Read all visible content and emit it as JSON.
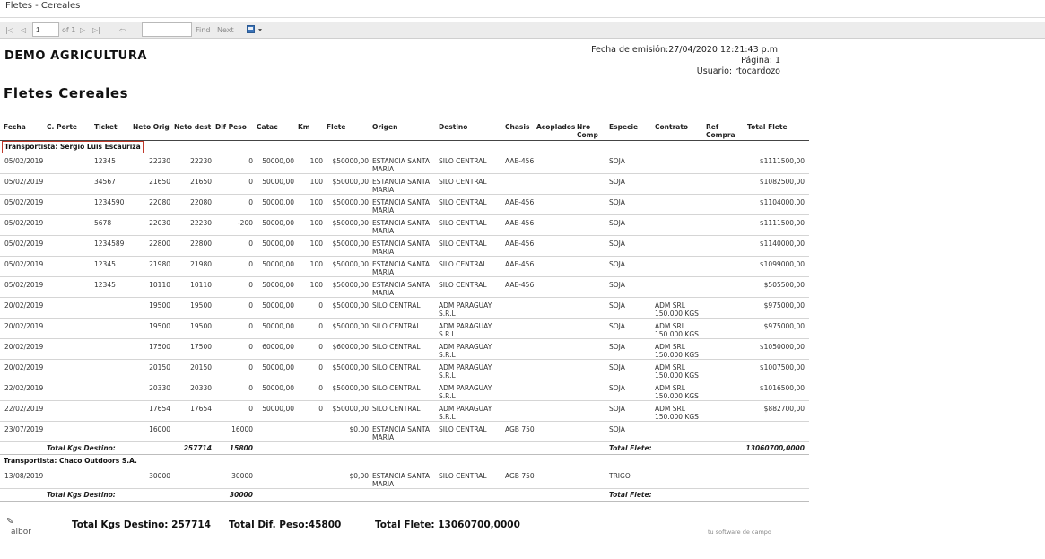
{
  "window": {
    "title": "Fletes - Cereales"
  },
  "toolbar": {
    "first_icon": "|◁",
    "prev_icon": "◁",
    "page_value": "1",
    "of_pages": "of 1",
    "next_icon": "▷",
    "last_icon": "▷|",
    "back_icon": "⇦",
    "search_value": "",
    "find_label": "Find",
    "separator": "|",
    "next_label": "Next",
    "export_icon": "save-icon"
  },
  "report": {
    "company": "DEMO AGRICULTURA",
    "title": "Fletes Cereales",
    "issue_line": "Fecha de emisión:27/04/2020 12:21:43 p.m.",
    "page_line": "Página: 1",
    "user_line": "Usuario: rtocardozo"
  },
  "columns": {
    "fecha": "Fecha",
    "cporte": "C. Porte",
    "ticket": "Ticket",
    "neto_orig": "Neto Orig",
    "neto_dest": "Neto dest",
    "dif_peso": "Dif Peso",
    "catac": "Catac",
    "km": "Km",
    "flete": "Flete",
    "origen": "Origen",
    "destino": "Destino",
    "chasis": "Chasis",
    "acoplados": "Acoplados",
    "nro_comp": "Nro Comp",
    "especie": "Especie",
    "contrato": "Contrato",
    "ref_compra": "Ref Compra",
    "total_flete": "Total Flete"
  },
  "groups": [
    {
      "title": "Transportista: Sergio Luis Escauriza",
      "rows": [
        {
          "fecha": "05/02/2019",
          "cporte": "",
          "ticket": "12345",
          "neto_orig": "22230",
          "neto_dest": "22230",
          "dif": "0",
          "catac": "50000,00",
          "km": "100",
          "flete": "$50000,00",
          "origen": "ESTANCIA SANTA MARIA",
          "destino": "SILO CENTRAL",
          "chasis": "AAE-456",
          "acoplados": "",
          "nro_comp": "",
          "especie": "SOJA",
          "contrato": "",
          "ref": "",
          "total": "$1111500,00"
        },
        {
          "fecha": "05/02/2019",
          "cporte": "",
          "ticket": "34567",
          "neto_orig": "21650",
          "neto_dest": "21650",
          "dif": "0",
          "catac": "50000,00",
          "km": "100",
          "flete": "$50000,00",
          "origen": "ESTANCIA SANTA MARIA",
          "destino": "SILO CENTRAL",
          "chasis": "",
          "acoplados": "",
          "nro_comp": "",
          "especie": "SOJA",
          "contrato": "",
          "ref": "",
          "total": "$1082500,00"
        },
        {
          "fecha": "05/02/2019",
          "cporte": "",
          "ticket": "1234590",
          "neto_orig": "22080",
          "neto_dest": "22080",
          "dif": "0",
          "catac": "50000,00",
          "km": "100",
          "flete": "$50000,00",
          "origen": "ESTANCIA SANTA MARIA",
          "destino": "SILO CENTRAL",
          "chasis": "AAE-456",
          "acoplados": "",
          "nro_comp": "",
          "especie": "SOJA",
          "contrato": "",
          "ref": "",
          "total": "$1104000,00"
        },
        {
          "fecha": "05/02/2019",
          "cporte": "",
          "ticket": "5678",
          "neto_orig": "22030",
          "neto_dest": "22230",
          "dif": "-200",
          "catac": "50000,00",
          "km": "100",
          "flete": "$50000,00",
          "origen": "ESTANCIA SANTA MARIA",
          "destino": "SILO CENTRAL",
          "chasis": "AAE-456",
          "acoplados": "",
          "nro_comp": "",
          "especie": "SOJA",
          "contrato": "",
          "ref": "",
          "total": "$1111500,00"
        },
        {
          "fecha": "05/02/2019",
          "cporte": "",
          "ticket": "1234589",
          "neto_orig": "22800",
          "neto_dest": "22800",
          "dif": "0",
          "catac": "50000,00",
          "km": "100",
          "flete": "$50000,00",
          "origen": "ESTANCIA SANTA MARIA",
          "destino": "SILO CENTRAL",
          "chasis": "AAE-456",
          "acoplados": "",
          "nro_comp": "",
          "especie": "SOJA",
          "contrato": "",
          "ref": "",
          "total": "$1140000,00"
        },
        {
          "fecha": "05/02/2019",
          "cporte": "",
          "ticket": "12345",
          "neto_orig": "21980",
          "neto_dest": "21980",
          "dif": "0",
          "catac": "50000,00",
          "km": "100",
          "flete": "$50000,00",
          "origen": "ESTANCIA SANTA MARIA",
          "destino": "SILO CENTRAL",
          "chasis": "AAE-456",
          "acoplados": "",
          "nro_comp": "",
          "especie": "SOJA",
          "contrato": "",
          "ref": "",
          "total": "$1099000,00"
        },
        {
          "fecha": "05/02/2019",
          "cporte": "",
          "ticket": "12345",
          "neto_orig": "10110",
          "neto_dest": "10110",
          "dif": "0",
          "catac": "50000,00",
          "km": "100",
          "flete": "$50000,00",
          "origen": "ESTANCIA SANTA MARIA",
          "destino": "SILO CENTRAL",
          "chasis": "AAE-456",
          "acoplados": "",
          "nro_comp": "",
          "especie": "SOJA",
          "contrato": "",
          "ref": "",
          "total": "$505500,00"
        },
        {
          "fecha": "20/02/2019",
          "cporte": "",
          "ticket": "",
          "neto_orig": "19500",
          "neto_dest": "19500",
          "dif": "0",
          "catac": "50000,00",
          "km": "0",
          "flete": "$50000,00",
          "origen": "SILO CENTRAL",
          "destino": "ADM PARAGUAY S.R.L",
          "chasis": "",
          "acoplados": "",
          "nro_comp": "",
          "especie": "SOJA",
          "contrato": "ADM SRL 150.000 KGS",
          "ref": "",
          "total": "$975000,00"
        },
        {
          "fecha": "20/02/2019",
          "cporte": "",
          "ticket": "",
          "neto_orig": "19500",
          "neto_dest": "19500",
          "dif": "0",
          "catac": "50000,00",
          "km": "0",
          "flete": "$50000,00",
          "origen": "SILO CENTRAL",
          "destino": "ADM PARAGUAY S.R.L",
          "chasis": "",
          "acoplados": "",
          "nro_comp": "",
          "especie": "SOJA",
          "contrato": "ADM SRL 150.000 KGS",
          "ref": "",
          "total": "$975000,00"
        },
        {
          "fecha": "20/02/2019",
          "cporte": "",
          "ticket": "",
          "neto_orig": "17500",
          "neto_dest": "17500",
          "dif": "0",
          "catac": "60000,00",
          "km": "0",
          "flete": "$60000,00",
          "origen": "SILO CENTRAL",
          "destino": "ADM PARAGUAY S.R.L",
          "chasis": "",
          "acoplados": "",
          "nro_comp": "",
          "especie": "SOJA",
          "contrato": "ADM SRL 150.000 KGS",
          "ref": "",
          "total": "$1050000,00"
        },
        {
          "fecha": "20/02/2019",
          "cporte": "",
          "ticket": "",
          "neto_orig": "20150",
          "neto_dest": "20150",
          "dif": "0",
          "catac": "50000,00",
          "km": "0",
          "flete": "$50000,00",
          "origen": "SILO CENTRAL",
          "destino": "ADM PARAGUAY S.R.L",
          "chasis": "",
          "acoplados": "",
          "nro_comp": "",
          "especie": "SOJA",
          "contrato": "ADM SRL 150.000 KGS",
          "ref": "",
          "total": "$1007500,00"
        },
        {
          "fecha": "22/02/2019",
          "cporte": "",
          "ticket": "",
          "neto_orig": "20330",
          "neto_dest": "20330",
          "dif": "0",
          "catac": "50000,00",
          "km": "0",
          "flete": "$50000,00",
          "origen": "SILO CENTRAL",
          "destino": "ADM PARAGUAY S.R.L",
          "chasis": "",
          "acoplados": "",
          "nro_comp": "",
          "especie": "SOJA",
          "contrato": "ADM SRL 150.000 KGS",
          "ref": "",
          "total": "$1016500,00"
        },
        {
          "fecha": "22/02/2019",
          "cporte": "",
          "ticket": "",
          "neto_orig": "17654",
          "neto_dest": "17654",
          "dif": "0",
          "catac": "50000,00",
          "km": "0",
          "flete": "$50000,00",
          "origen": "SILO CENTRAL",
          "destino": "ADM PARAGUAY S.R.L",
          "chasis": "",
          "acoplados": "",
          "nro_comp": "",
          "especie": "SOJA",
          "contrato": "ADM SRL 150.000 KGS",
          "ref": "",
          "total": "$882700,00"
        },
        {
          "fecha": "23/07/2019",
          "cporte": "",
          "ticket": "",
          "neto_orig": "16000",
          "neto_dest": "",
          "dif": "16000",
          "catac": "",
          "km": "",
          "flete": "$0,00",
          "origen": "ESTANCIA SANTA MARIA",
          "destino": "SILO CENTRAL",
          "chasis": "AGB 750",
          "acoplados": "",
          "nro_comp": "",
          "especie": "SOJA",
          "contrato": "",
          "ref": "",
          "total": ""
        }
      ],
      "total_kgs_label": "Total Kgs Destino:",
      "total_kgs": "257714",
      "total_dif": "15800",
      "total_flete_label": "Total Flete:",
      "total_flete": "13060700,0000"
    },
    {
      "title": "Transportista: Chaco Outdoors S.A.",
      "rows": [
        {
          "fecha": "13/08/2019",
          "cporte": "",
          "ticket": "",
          "neto_orig": "30000",
          "neto_dest": "",
          "dif": "30000",
          "catac": "",
          "km": "",
          "flete": "$0,00",
          "origen": "ESTANCIA SANTA MARIA",
          "destino": "SILO CENTRAL",
          "chasis": "AGB 750",
          "acoplados": "",
          "nro_comp": "",
          "especie": "TRIGO",
          "contrato": "",
          "ref": "",
          "total": ""
        }
      ],
      "total_kgs_label": "Total Kgs Destino:",
      "total_kgs": "",
      "total_dif": "30000",
      "total_flete_label": "Total Flete:",
      "total_flete": ""
    }
  ],
  "footer": {
    "logo_text": "albor",
    "total_kgs": "Total Kgs Destino: 257714",
    "total_dif": "Total Dif. Peso:45800",
    "total_flete": "Total Flete: 13060700,0000",
    "tagline": "tu software de campo"
  }
}
